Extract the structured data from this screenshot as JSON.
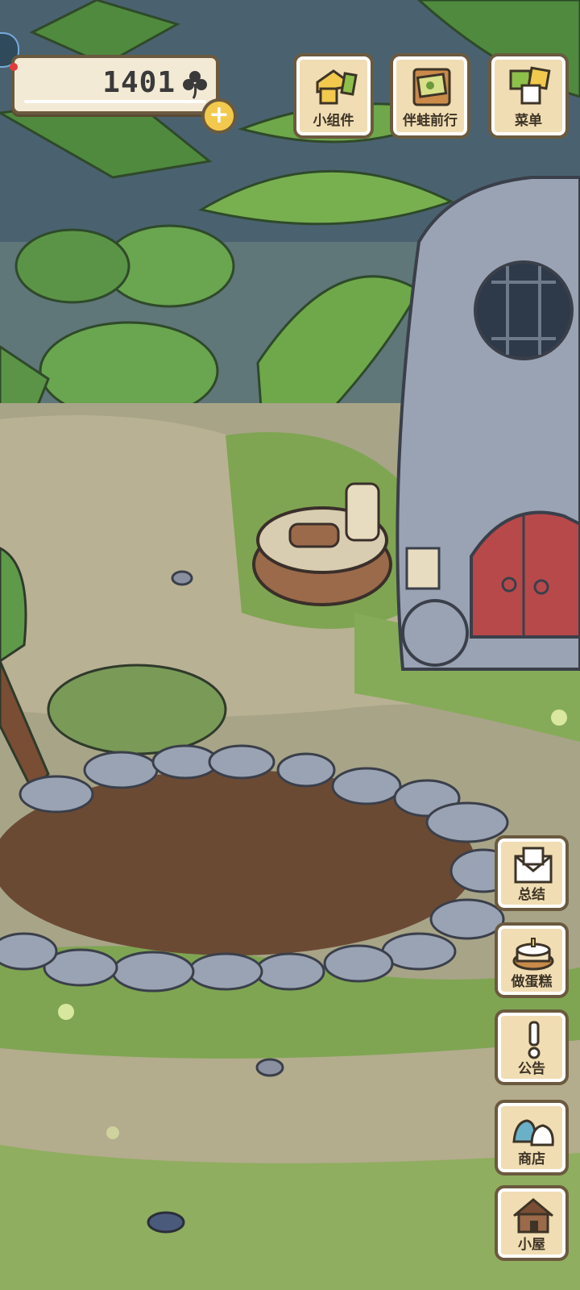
{
  "currency": {
    "clover_count": "1401",
    "add_label": "+"
  },
  "top_menu": {
    "widgets": "小组件",
    "travel_with_frog": "伴蛙前行",
    "menu": "菜单"
  },
  "side_menu": {
    "summary": "总结",
    "make_cake": "做蛋糕",
    "notice": "公告",
    "shop": "商店",
    "cabin": "小屋"
  },
  "colors": {
    "button_bg": "#f1ddb3",
    "button_border": "#6b5a3f",
    "plus_yellow": "#f2c94c",
    "door_red": "#b8494a",
    "grass": "#7fa552",
    "soil": "#6b4a34"
  }
}
